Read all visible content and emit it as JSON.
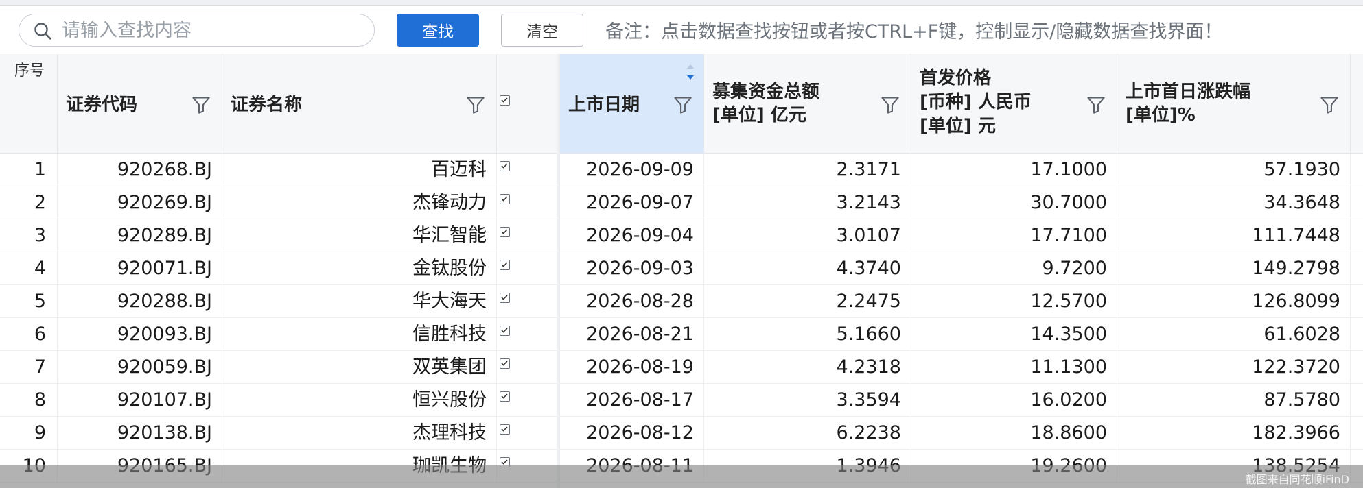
{
  "search": {
    "placeholder": "请输入查找内容",
    "find_label": "查找",
    "clear_label": "清空",
    "remark": "备注：点击数据查找按钮或者按CTRL+F键，控制显示/隐藏数据查找界面！"
  },
  "colors": {
    "accent": "#1f6fd6",
    "sorted_header_bg": "#d9e8fb",
    "sort_arrow": "#1f6fd6"
  },
  "table": {
    "seq_header": "序号",
    "headers": {
      "code": [
        "证券代码"
      ],
      "name": [
        "证券名称"
      ],
      "date": [
        "上市日期"
      ],
      "funds": [
        "募集资金总额",
        "[单位]  亿元"
      ],
      "price": [
        "首发价格",
        "[币种]  人民币",
        "[单位]   元"
      ],
      "change": [
        "上市首日涨跌幅",
        "[单位]%"
      ]
    },
    "rows": [
      {
        "seq": "1",
        "code": "920268.BJ",
        "name": "百迈科",
        "date": "2026-09-09",
        "funds": "2.3171",
        "price": "17.1000",
        "change": "57.1930"
      },
      {
        "seq": "2",
        "code": "920269.BJ",
        "name": "杰锋动力",
        "date": "2026-09-07",
        "funds": "3.2143",
        "price": "30.7000",
        "change": "34.3648"
      },
      {
        "seq": "3",
        "code": "920289.BJ",
        "name": "华汇智能",
        "date": "2026-09-04",
        "funds": "3.0107",
        "price": "17.7100",
        "change": "111.7448"
      },
      {
        "seq": "4",
        "code": "920071.BJ",
        "name": "金钛股份",
        "date": "2026-09-03",
        "funds": "4.3740",
        "price": "9.7200",
        "change": "149.2798"
      },
      {
        "seq": "5",
        "code": "920288.BJ",
        "name": "华大海天",
        "date": "2026-08-28",
        "funds": "2.2475",
        "price": "12.5700",
        "change": "126.8099"
      },
      {
        "seq": "6",
        "code": "920093.BJ",
        "name": "信胜科技",
        "date": "2026-08-21",
        "funds": "5.1660",
        "price": "14.3500",
        "change": "61.6028"
      },
      {
        "seq": "7",
        "code": "920059.BJ",
        "name": "双英集团",
        "date": "2026-08-19",
        "funds": "4.2318",
        "price": "11.1300",
        "change": "122.3720"
      },
      {
        "seq": "8",
        "code": "920107.BJ",
        "name": "恒兴股份",
        "date": "2026-08-17",
        "funds": "3.3594",
        "price": "16.0200",
        "change": "87.5780"
      },
      {
        "seq": "9",
        "code": "920138.BJ",
        "name": "杰理科技",
        "date": "2026-08-12",
        "funds": "6.2238",
        "price": "18.8600",
        "change": "182.3966"
      },
      {
        "seq": "10",
        "code": "920165.BJ",
        "name": "珈凯生物",
        "date": "2026-08-11",
        "funds": "1.3946",
        "price": "19.2600",
        "change": "138.5254"
      }
    ]
  },
  "watermark": "截图来自同花顺iFinD"
}
